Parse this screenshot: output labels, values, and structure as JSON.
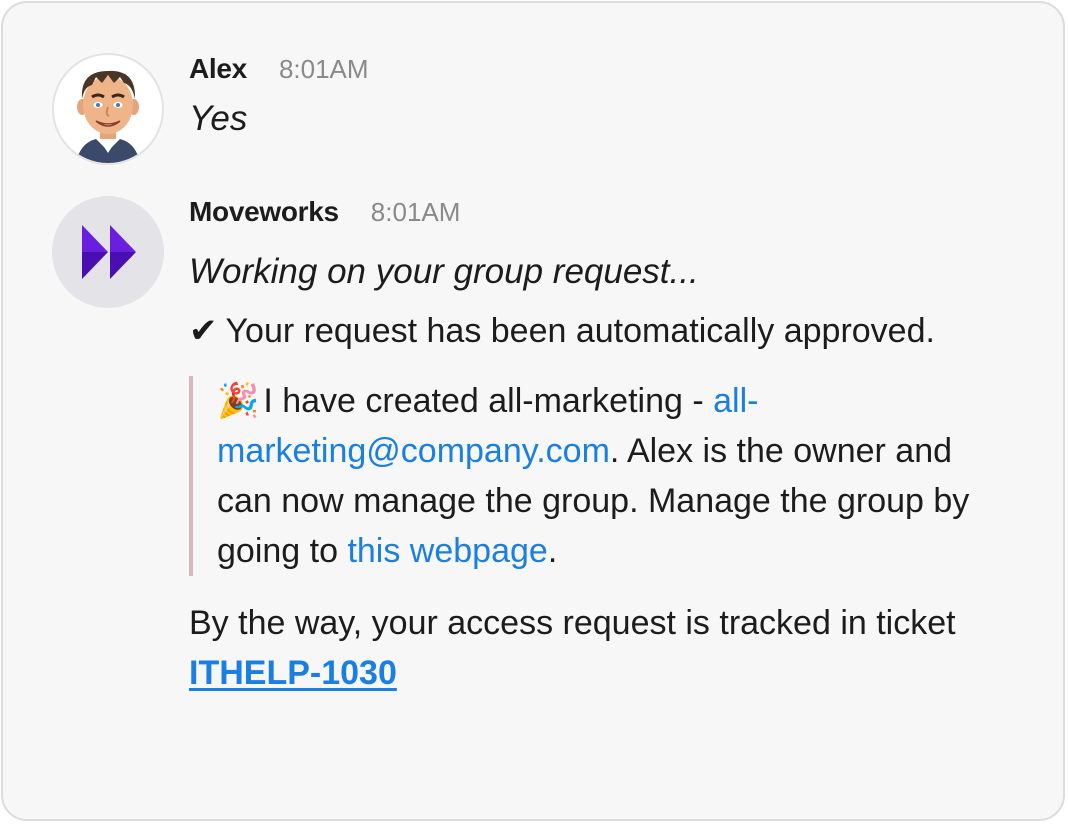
{
  "messages": {
    "alex": {
      "name": "Alex",
      "time": "8:01AM",
      "text": "Yes"
    },
    "moveworks": {
      "name": "Moveworks",
      "time": "8:01AM",
      "status": "Working on your group request...",
      "approval": {
        "check": "✔",
        "text": "Your request has been automatically approved."
      },
      "quote": {
        "emoji": "🎉",
        "text_1": "I have created all-marketing - ",
        "email_link": "all-marketing@company.com",
        "text_2": ". Alex is the owner and can now manage the group. Manage the group by going to ",
        "webpage_link": "this webpage",
        "text_3": "."
      },
      "tracking": {
        "text": "By the way, your access request is tracked in ticket ",
        "ticket_link": "ITHELP-1030"
      }
    }
  },
  "colors": {
    "link": "#1a7fe3",
    "brand_purple": "#5b14d6",
    "quote_bar": "#d9b6bd"
  }
}
